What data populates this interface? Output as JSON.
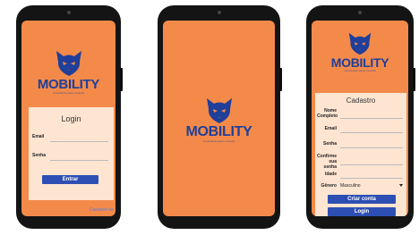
{
  "brand": {
    "name": "MOBILITY",
    "tagline": "conectando quem conecta"
  },
  "login": {
    "title": "Login",
    "email_label": "Email",
    "senha_label": "Senha",
    "submit_label": "Entrar",
    "register_link": "Cadastre-se"
  },
  "cadastro": {
    "title": "Cadastro",
    "nome_label": "Nome Completo",
    "email_label": "Email",
    "senha_label": "Senha",
    "confirme_label": "Confirme sua senha",
    "idade_label": "Idade",
    "genero_label": "Gênero",
    "genero_value": "Masculino",
    "create_label": "Criar conta",
    "login_label": "Login"
  },
  "colors": {
    "background": "#f48a4a",
    "brand_blue": "#1f3f9a",
    "button_blue": "#2d4fb3",
    "card": "#fde5d2"
  }
}
